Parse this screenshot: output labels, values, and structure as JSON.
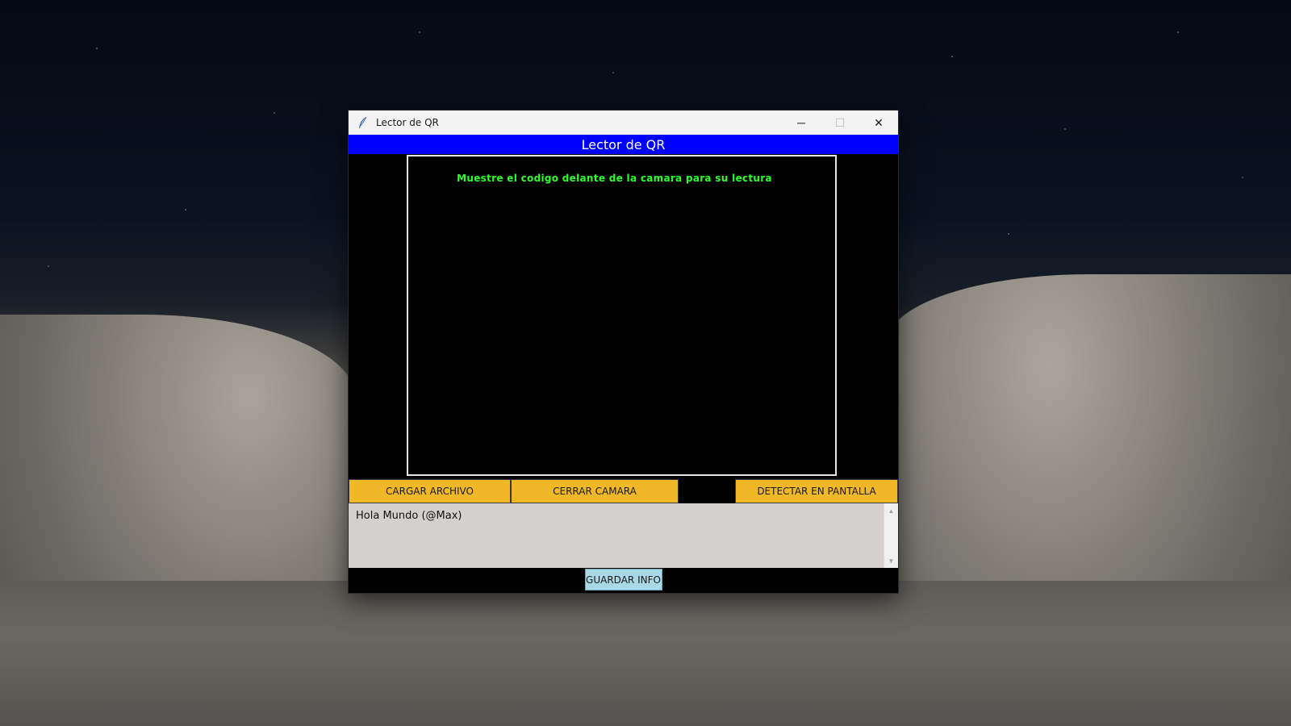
{
  "window": {
    "title": "Lector de QR",
    "controls": {
      "minimize": "─",
      "maximize": "☐",
      "close": "✕"
    }
  },
  "header": {
    "banner_text": "Lector de QR"
  },
  "camera": {
    "message": "Muestre el codigo delante de la camara para su lectura"
  },
  "buttons": {
    "cargar_archivo": "CARGAR ARCHIVO",
    "cerrar_camara": "CERRAR CAMARA",
    "detectar_en_pantalla": "DETECTAR EN PANTALLA",
    "guardar_info": "GUARDAR INFO"
  },
  "output": {
    "text": "Hola Mundo (@Max)"
  },
  "colors": {
    "banner_bg": "#0000ff",
    "button_yellow": "#f0b727",
    "button_guardar": "#a9d8e6",
    "message_green": "#2bff2b",
    "text_area_bg": "#d4d0ce"
  },
  "icons": {
    "app": "feather-icon",
    "scroll_up": "scroll-up-arrow-icon",
    "scroll_down": "scroll-down-arrow-icon"
  }
}
